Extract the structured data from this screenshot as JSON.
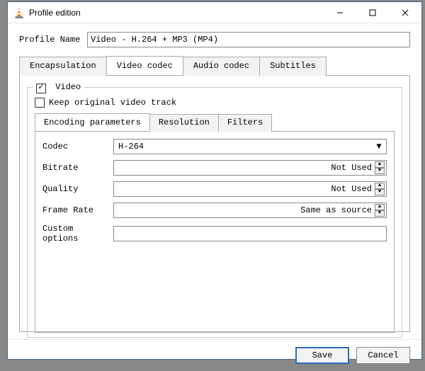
{
  "window": {
    "title": "Profile edition"
  },
  "profile": {
    "name_label": "Profile Name",
    "name_value": "Video - H.264 + MP3 (MP4)"
  },
  "tabs": {
    "items": [
      "Encapsulation",
      "Video codec",
      "Audio codec",
      "Subtitles"
    ],
    "active": 1
  },
  "video": {
    "checkbox_label": "Video",
    "checked": true,
    "keep_label": "Keep original video track",
    "keep_checked": false
  },
  "inner_tabs": {
    "items": [
      "Encoding parameters",
      "Resolution",
      "Filters"
    ],
    "active": 0
  },
  "encoding": {
    "codec_label": "Codec",
    "codec_value": "H-264",
    "bitrate_label": "Bitrate",
    "bitrate_value": "Not Used",
    "quality_label": "Quality",
    "quality_value": "Not Used",
    "framerate_label": "Frame Rate",
    "framerate_value": "Same as source",
    "custom_label": "Custom options",
    "custom_value": ""
  },
  "footer": {
    "save": "Save",
    "cancel": "Cancel"
  }
}
